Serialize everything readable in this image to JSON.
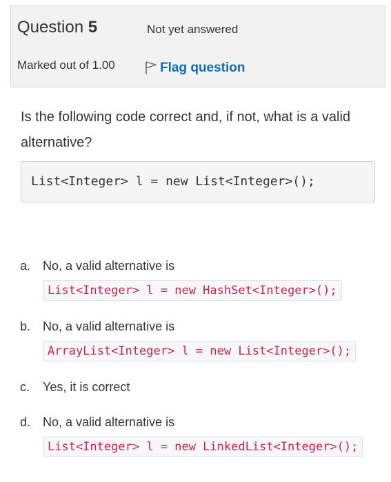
{
  "info": {
    "question_label": "Question",
    "question_number": "5",
    "state": "Not yet answered",
    "grade": "Marked out of 1.00",
    "flag_label": "Flag question"
  },
  "question": {
    "text": "Is the following code correct and, if not, what is a valid alternative?",
    "code": "List<Integer> l = new List<Integer>();"
  },
  "options": [
    {
      "letter": "a.",
      "text": "No, a valid alternative is",
      "code": "List<Integer> l = new HashSet<Integer>();"
    },
    {
      "letter": "b.",
      "text": "No, a valid alternative is",
      "code": "ArrayList<Integer> l = new List<Integer>();"
    },
    {
      "letter": "c.",
      "text": "Yes, it is correct",
      "code": ""
    },
    {
      "letter": "d.",
      "text": "No, a valid alternative is",
      "code": "List<Integer> l = new LinkedList<Integer>();"
    }
  ],
  "colors": {
    "info_bg": "#f2f2f2",
    "link": "#0f6cbf",
    "code_inline": "#c7254e"
  },
  "icons": {
    "flag": "flag-outline-icon"
  }
}
